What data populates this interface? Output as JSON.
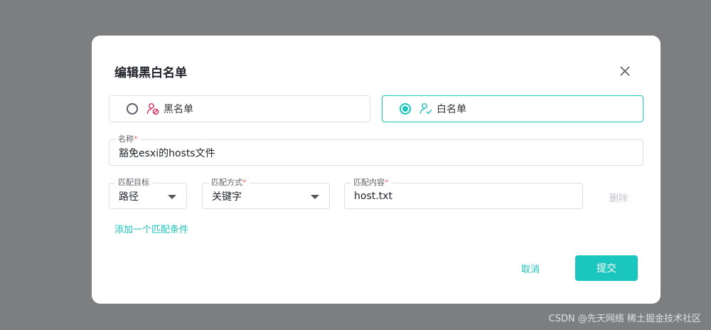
{
  "dialog": {
    "title": "编辑黑白名单",
    "close_icon": "close-icon"
  },
  "list_type": {
    "options": [
      {
        "label": "黑名单",
        "icon": "user-block-icon",
        "selected": false
      },
      {
        "label": "白名单",
        "icon": "user-check-icon",
        "selected": true
      }
    ]
  },
  "name_field": {
    "label": "名称",
    "value": "豁免esxi的hosts文件"
  },
  "condition": {
    "target": {
      "label": "匹配目标",
      "value": "路径"
    },
    "mode": {
      "label": "匹配方式",
      "value": "关键字"
    },
    "content": {
      "label": "匹配内容",
      "value": "host.txt"
    },
    "delete_label": "删除"
  },
  "add_condition_label": "添加一个匹配条件",
  "footer": {
    "cancel_label": "取消",
    "submit_label": "提交"
  },
  "watermark": "CSDN @先天网络 稀土掘金技术社区",
  "colors": {
    "accent": "#1ac6bd",
    "overlay": "#7d7e80",
    "danger_icon": "#e0245e",
    "required": "#f56c6c"
  }
}
